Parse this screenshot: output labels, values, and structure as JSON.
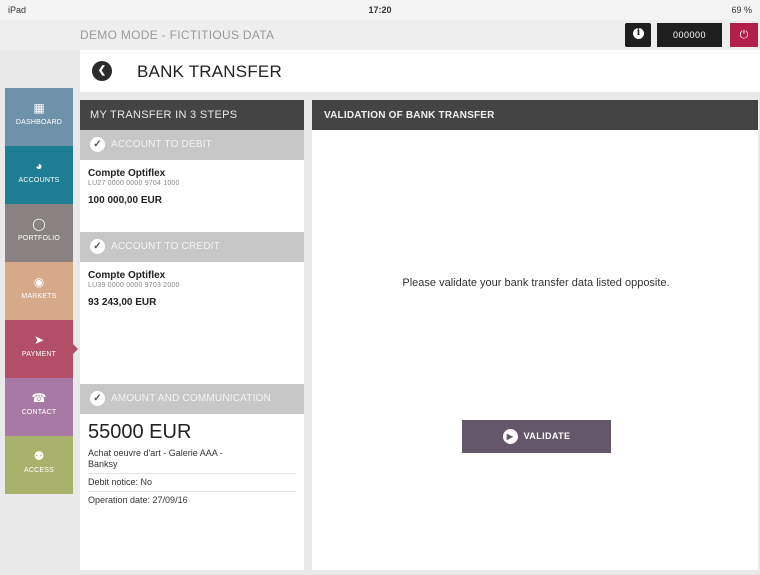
{
  "status_bar": {
    "device": "iPad",
    "time": "17:20",
    "battery": "69 %"
  },
  "top_bar": {
    "demo_label": "DEMO MODE - FICTITIOUS DATA",
    "info_icon": "info-icon",
    "code": "000000",
    "power_icon": "power-icon"
  },
  "title_bar": {
    "back_icon": "back-arrow-icon",
    "title": "BANK TRANSFER"
  },
  "sidebar": {
    "items": [
      {
        "label": "DASHBOARD",
        "icon": "grid-icon",
        "color": "#6f92ab"
      },
      {
        "label": "ACCOUNTS",
        "icon": "pie-chart-icon",
        "color": "#1d7e93"
      },
      {
        "label": "PORTFOLIO",
        "icon": "circle-icon",
        "color": "#8a8282"
      },
      {
        "label": "MARKETS",
        "icon": "globe-icon",
        "color": "#d6a98b"
      },
      {
        "label": "PAYMENT",
        "icon": "payment-icon",
        "color": "#b24e66",
        "active": true
      },
      {
        "label": "CONTACT",
        "icon": "phone-icon",
        "color": "#a979a6"
      },
      {
        "label": "ACCESS",
        "icon": "key-icon",
        "color": "#a9b26c"
      }
    ]
  },
  "steps": {
    "header": "MY TRANSFER IN 3 STEPS",
    "debit": {
      "header": "ACCOUNT TO DEBIT",
      "name": "Compte Optiflex",
      "iban": "LU27 0000 0000 9704 1000",
      "balance": "100 000,00 EUR"
    },
    "credit": {
      "header": "ACCOUNT TO CREDIT",
      "name": "Compte Optiflex",
      "iban": "LU39 0000 0000 9703 2000",
      "balance": "93 243,00 EUR"
    },
    "amount": {
      "header": "AMOUNT AND COMMUNICATION",
      "value": "55000 EUR",
      "communication_line1": "Achat oeuvre d'art - Galerie AAA -",
      "communication_line2": "Banksy",
      "debit_notice": "Debit notice: No",
      "operation_date": "Operation date: 27/09/16"
    }
  },
  "validation": {
    "header": "VALIDATION OF BANK TRANSFER",
    "message": "Please validate your bank transfer data listed opposite.",
    "button_label": "VALIDATE"
  },
  "colors": {
    "panel_header": "#444444",
    "step_header": "#c7c7c7",
    "validate_button": "#645769",
    "power_button": "#b21f4a"
  }
}
